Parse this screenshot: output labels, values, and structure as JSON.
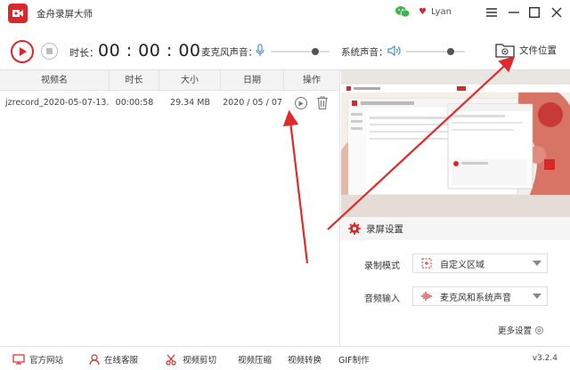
{
  "app": {
    "title": "金舟录屏大师",
    "logo_icon": "video-record-icon",
    "accent": "#d8282b"
  },
  "user": {
    "name": "Lyan",
    "login_icon": "wechat-icon",
    "vip_icon": "heart-icon"
  },
  "window": {
    "menu_icon": "hamburger-icon",
    "minimize_icon": "minimize-icon",
    "maximize_icon": "maximize-icon",
    "close_icon": "close-icon"
  },
  "toolbar": {
    "duration_label": "时长：",
    "duration_value": "00 : 00 : 00",
    "mic_label": "麦克风声音：",
    "mic_level": 0.75,
    "system_label": "系统声音：",
    "system_level": 0.75,
    "file_location_label": "文件位置"
  },
  "table": {
    "columns": [
      "视频名",
      "时长",
      "大小",
      "日期",
      "操作"
    ],
    "rows": [
      {
        "name": "jzrecord_2020-05-07-13...",
        "duration": "00:00:58",
        "size": "29.34 MB",
        "date": "2020 / 05 / 07"
      }
    ]
  },
  "settings": {
    "title": "录屏设置",
    "mode_label": "录制模式",
    "mode_value": "自定义区域",
    "audio_label": "音频输入",
    "audio_value": "麦克风和系统声音",
    "more_label": "更多设置"
  },
  "footer": {
    "items": [
      "官方网站",
      "在线客服",
      "视频剪切",
      "视频压缩",
      "视频转换",
      "GIF制作"
    ],
    "version": "v3.2.4"
  }
}
